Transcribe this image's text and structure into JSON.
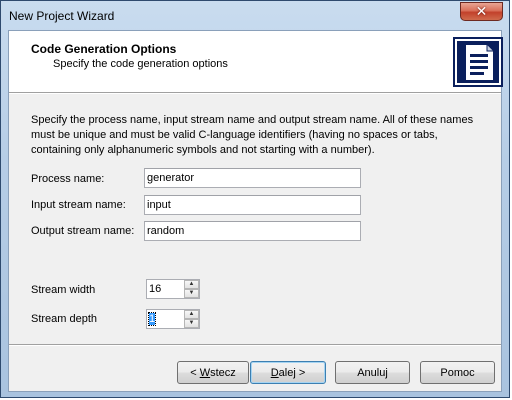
{
  "window": {
    "title": "New Project Wizard",
    "close_glyph": "✕"
  },
  "header": {
    "title": "Code Generation Options",
    "subtitle": "Specify the code generation options",
    "icon": "document-icon"
  },
  "description": "Specify the process name, input stream name and output stream name. All of these names must be unique and must be valid C-language identifiers (having no spaces or tabs, containing only alphanumeric symbols and not starting with a number).",
  "fields": {
    "process_name": {
      "label": "Process name:",
      "value": "generator"
    },
    "input_stream": {
      "label": "Input stream name:",
      "value": "input"
    },
    "output_stream": {
      "label": "Output stream name:",
      "value": "random"
    },
    "stream_width": {
      "label": "Stream width",
      "value": "16"
    },
    "stream_depth": {
      "label": "Stream depth",
      "value": "1"
    }
  },
  "buttons": {
    "back": {
      "prefix": "< ",
      "mnemonic": "W",
      "rest": "stecz"
    },
    "next": {
      "mnemonic": "D",
      "rest": "alej >"
    },
    "cancel": {
      "label": "Anuluj"
    },
    "help": {
      "label": "Pomoc"
    }
  },
  "colors": {
    "title_bar": "#b6cde6",
    "close_button": "#c2412b",
    "selection": "#3399ff",
    "default_button_border": "#3c7fb1"
  }
}
